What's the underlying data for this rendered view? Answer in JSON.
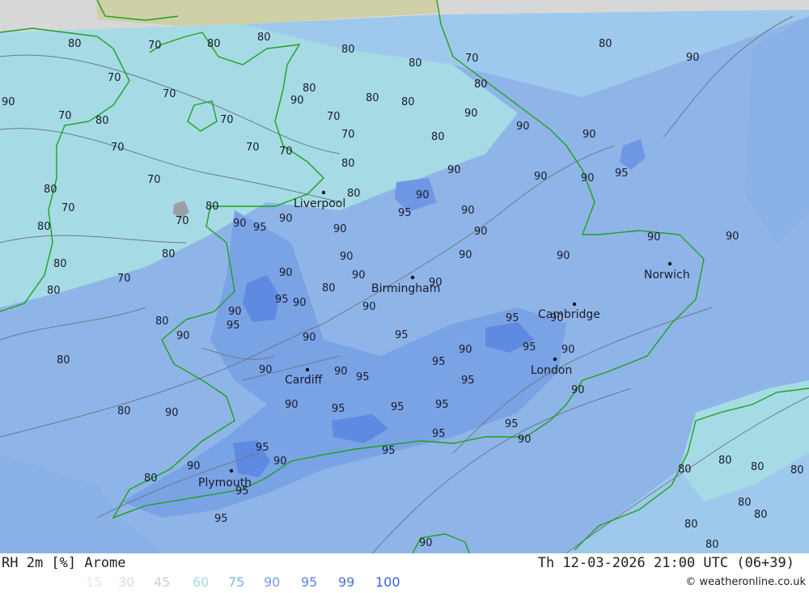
{
  "map": {
    "colors": {
      "c60": "#a6dbe6",
      "c75": "#9ec9ec",
      "c90": "#8fb5e8",
      "c95": "#6e96e4",
      "c99": "#5a83e0",
      "land_top": "#cfcfa8",
      "sea_top": "#d7d7d7",
      "coast": "#1ea21e",
      "contour": "#6a7a8a"
    },
    "cities": [
      {
        "name": "Liverpool"
      },
      {
        "name": "Birmingham"
      },
      {
        "name": "Norwich"
      },
      {
        "name": "Cambridge"
      },
      {
        "name": "London"
      },
      {
        "name": "Cardiff"
      },
      {
        "name": "Plymouth"
      }
    ],
    "contour_labels": [
      "70",
      "80",
      "90",
      "95"
    ]
  },
  "footer": {
    "title": "RH 2m [%] Arome",
    "datetime": "Th 12-03-2026 21:00 UTC (06+39)",
    "credit": "© weatheronline.co.uk",
    "legend": [
      {
        "label": "15",
        "color": "#e6e6e6"
      },
      {
        "label": "30",
        "color": "#dcdcdc"
      },
      {
        "label": "45",
        "color": "#c8d2d8"
      },
      {
        "label": "60",
        "color": "#a6dbe6"
      },
      {
        "label": "75",
        "color": "#7fb6e6"
      },
      {
        "label": "90",
        "color": "#6f9ee6"
      },
      {
        "label": "95",
        "color": "#5a86e2"
      },
      {
        "label": "99",
        "color": "#4a74de"
      },
      {
        "label": "100",
        "color": "#3a62da"
      }
    ]
  }
}
